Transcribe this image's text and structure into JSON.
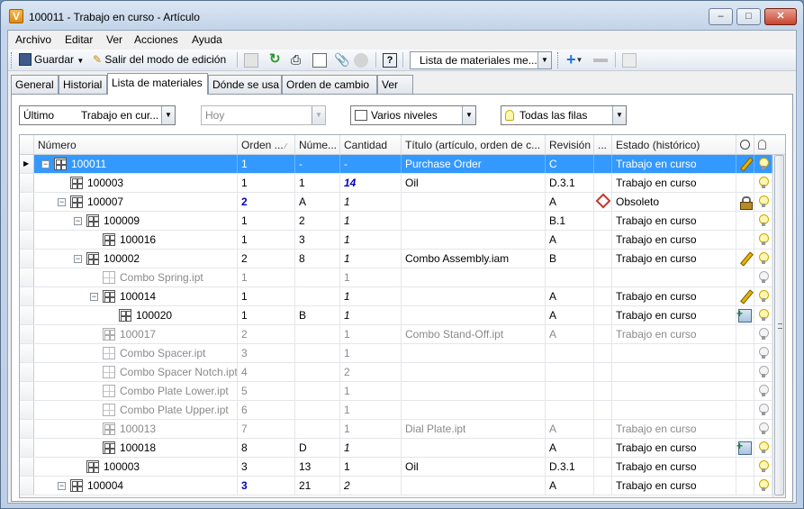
{
  "window": {
    "title": "100011 - Trabajo en curso - Artículo",
    "app_icon": "V"
  },
  "menu": [
    "Archivo",
    "Editar",
    "Ver",
    "Acciones",
    "Ayuda"
  ],
  "toolbar": {
    "save_label": "Guardar",
    "exit_edit_label": "Salir del modo de edición",
    "view_combo": "Lista de materiales me..."
  },
  "tabs": [
    "General",
    "Historial",
    "Lista de materiales",
    "Dónde se usa",
    "Orden de cambio",
    "Ver"
  ],
  "filters": {
    "revision_combo_left": "Último",
    "revision_combo_right": "Trabajo en cur...",
    "date_combo": "Hoy",
    "levels_combo": "Varios niveles",
    "rows_combo": "Todas las filas"
  },
  "grid": {
    "columns": [
      "Número",
      "Orden ...",
      "Núme...",
      "Cantidad",
      "Título (artículo, orden de c...",
      "Revisión",
      "...",
      "Estado (histórico)"
    ],
    "rows": [
      {
        "number": "100011",
        "order": "1",
        "num": "-",
        "qty": "-",
        "title": "Purchase Order",
        "rev": "C",
        "state": "Trabajo en curso"
      },
      {
        "number": "100003",
        "order": "1",
        "num": "1",
        "qty": "14",
        "title": "Oil",
        "rev": "D.3.1",
        "state": "Trabajo en curso"
      },
      {
        "number": "100007",
        "order": "2",
        "num": "A",
        "qty": "1",
        "title": "",
        "rev": "A",
        "state": "Obsoleto"
      },
      {
        "number": "100009",
        "order": "1",
        "num": "2",
        "qty": "1",
        "title": "",
        "rev": "B.1",
        "state": "Trabajo en curso"
      },
      {
        "number": "100016",
        "order": "1",
        "num": "3",
        "qty": "1",
        "title": "",
        "rev": "A",
        "state": "Trabajo en curso"
      },
      {
        "number": "100002",
        "order": "2",
        "num": "8",
        "qty": "1",
        "title": "Combo Assembly.iam",
        "rev": "B",
        "state": "Trabajo en curso"
      },
      {
        "number": "Combo Spring.ipt",
        "order": "1",
        "num": "",
        "qty": "1",
        "title": "",
        "rev": "",
        "state": ""
      },
      {
        "number": "100014",
        "order": "1",
        "num": "",
        "qty": "1",
        "title": "",
        "rev": "A",
        "state": "Trabajo en curso"
      },
      {
        "number": "100020",
        "order": "1",
        "num": "B",
        "qty": "1",
        "title": "",
        "rev": "A",
        "state": "Trabajo en curso"
      },
      {
        "number": "100017",
        "order": "2",
        "num": "",
        "qty": "1",
        "title": "Combo Stand-Off.ipt",
        "rev": "A",
        "state": "Trabajo en curso"
      },
      {
        "number": "Combo Spacer.ipt",
        "order": "3",
        "num": "",
        "qty": "1",
        "title": "",
        "rev": "",
        "state": ""
      },
      {
        "number": "Combo Spacer Notch.ipt",
        "order": "4",
        "num": "",
        "qty": "2",
        "title": "",
        "rev": "",
        "state": ""
      },
      {
        "number": "Combo Plate Lower.ipt",
        "order": "5",
        "num": "",
        "qty": "1",
        "title": "",
        "rev": "",
        "state": ""
      },
      {
        "number": "Combo Plate Upper.ipt",
        "order": "6",
        "num": "",
        "qty": "1",
        "title": "",
        "rev": "",
        "state": ""
      },
      {
        "number": "100013",
        "order": "7",
        "num": "",
        "qty": "1",
        "title": "Dial Plate.ipt",
        "rev": "A",
        "state": "Trabajo en curso"
      },
      {
        "number": "100018",
        "order": "8",
        "num": "D",
        "qty": "1",
        "title": "",
        "rev": "A",
        "state": "Trabajo en curso"
      },
      {
        "number": "100003",
        "order": "3",
        "num": "13",
        "qty": "1",
        "title": "Oil",
        "rev": "D.3.1",
        "state": "Trabajo en curso"
      },
      {
        "number": "100004",
        "order": "3",
        "num": "21",
        "qty": "2",
        "title": "",
        "rev": "A",
        "state": "Trabajo en curso"
      }
    ]
  }
}
